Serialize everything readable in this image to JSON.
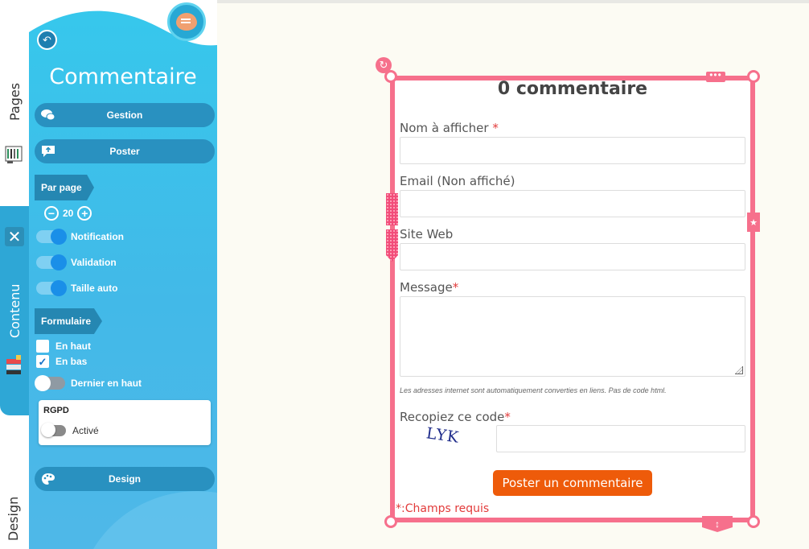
{
  "vtabs": {
    "pages": "Pages",
    "contenu": "Contenu",
    "design": "Design"
  },
  "panel": {
    "title": "Commentaire",
    "buttons": {
      "gestion": "Gestion",
      "poster": "Poster",
      "design": "Design"
    },
    "par_page": {
      "label": "Par page",
      "value": "20"
    },
    "toggles": [
      {
        "label": "Notification",
        "on": true
      },
      {
        "label": "Validation",
        "on": true
      },
      {
        "label": "Taille auto",
        "on": true
      }
    ],
    "formulaire": {
      "label": "Formulaire",
      "en_haut": "En haut",
      "en_haut_checked": false,
      "en_bas": "En bas",
      "en_bas_checked": true,
      "dernier_en_haut": "Dernier en haut",
      "dernier_en_haut_on": false
    },
    "rgpd": {
      "title": "RGPD",
      "toggle_label": "Activé",
      "on": false
    }
  },
  "form": {
    "title": "0 commentaire",
    "name_label": "Nom à afficher",
    "email_label": "Email (Non affiché)",
    "site_label": "Site Web",
    "message_label": "Message",
    "note": "Les adresses internet sont automatiquement converties en liens. Pas de code html.",
    "captcha_label": "Recopiez ce code",
    "captcha_code": "LYK",
    "submit": "Poster un commentaire",
    "required_note": "*:Champs requis",
    "required_marker": "*"
  },
  "colors": {
    "accent": "#f6708c",
    "panel": "#36c8ec",
    "submit": "#ee5b0a"
  }
}
